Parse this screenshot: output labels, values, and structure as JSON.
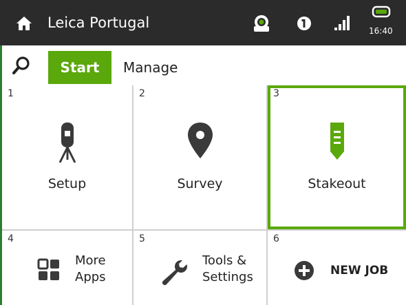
{
  "titlebar": {
    "title": "Leica Portugal",
    "time": "16:40",
    "icons": [
      "home-icon",
      "gnss-icon",
      "info-icon",
      "signal-icon",
      "battery-icon"
    ]
  },
  "tabs": {
    "start_label": "Start",
    "manage_label": "Manage",
    "active": "Start"
  },
  "tiles": [
    {
      "num": "1",
      "label": "Setup",
      "icon": "tripod-icon"
    },
    {
      "num": "2",
      "label": "Survey",
      "icon": "map-pin-icon"
    },
    {
      "num": "3",
      "label": "Stakeout",
      "icon": "stake-icon",
      "selected": true
    },
    {
      "num": "4",
      "label_line1": "More",
      "label_line2": "Apps",
      "icon": "apps-grid-icon"
    },
    {
      "num": "5",
      "label_line1": "Tools &",
      "label_line2": "Settings",
      "icon": "wrench-icon"
    },
    {
      "num": "6",
      "label": "NEW JOB",
      "icon": "plus-circle-icon"
    }
  ],
  "colors": {
    "accent": "#5aa80b",
    "titlebar_bg": "#2b2b2b",
    "icon_dark": "#3a3a3a",
    "edge": "#2e7d32"
  }
}
